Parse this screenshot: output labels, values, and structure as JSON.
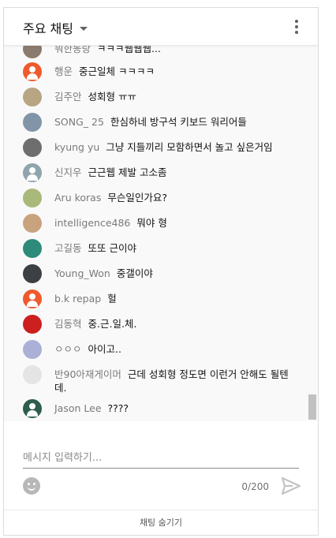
{
  "header": {
    "title": "주요 채팅",
    "menu_icon": "more-vert-icon"
  },
  "messages": [
    {
      "author": "뭐한동랑",
      "text": "ㅋㅋㅋ웹웹웹...",
      "avatar": "photo",
      "color": "#8a7b6e"
    },
    {
      "author": "행운",
      "text": "중근일체 ㅋㅋㅋㅋ",
      "avatar": "default",
      "color": "#ef5a2d"
    },
    {
      "author": "김주안",
      "text": "성회형 ㅠㅠ",
      "avatar": "photo",
      "color": "#b7a583"
    },
    {
      "author": "SONG_ 25",
      "text": "한심하네 방구석 키보드 워리어들",
      "avatar": "photo",
      "color": "#8294a8"
    },
    {
      "author": "kyung yu",
      "text": "그냥 지들끼리 모함하면서 놀고 싶은거임",
      "avatar": "photo",
      "color": "#6e6e6e"
    },
    {
      "author": "신지우",
      "text": "근근웹 제발 고소좀",
      "avatar": "default",
      "color": "#90a4ae"
    },
    {
      "author": "Aru koras",
      "text": "무슨일인가요?",
      "avatar": "photo",
      "color": "#a8b97a"
    },
    {
      "author": "intelligence486",
      "text": "뭐야 형",
      "avatar": "photo",
      "color": "#c9a27e"
    },
    {
      "author": "고길동",
      "text": "또또 근이야",
      "avatar": "photo",
      "color": "#2e8b7a"
    },
    {
      "author": "Young_Won",
      "text": "중갤이야",
      "avatar": "photo",
      "color": "#3c3f44"
    },
    {
      "author": "b.k repap",
      "text": "헐",
      "avatar": "default",
      "color": "#ef5a2d"
    },
    {
      "author": "김동혁",
      "text": "중.근.일.체.",
      "avatar": "photo",
      "color": "#cc1f1f"
    },
    {
      "author": "ㅇㅇㅇ",
      "text": "아이고..",
      "avatar": "photo",
      "color": "#aab0d6"
    },
    {
      "author": "반90아재게이머",
      "text": "근데 성회형 정도면 이런거 안해도 될텐데.",
      "avatar": "photo",
      "color": "#e4e4e4"
    },
    {
      "author": "Jason Lee",
      "text": "????",
      "avatar": "default",
      "color": "#2d5d4e"
    }
  ],
  "composer": {
    "placeholder": "메시지 입력하기...",
    "counter": "0/200",
    "emoji_icon": "emoji-icon",
    "send_icon": "send-icon"
  },
  "footer": {
    "hide_label": "채팅 숨기기"
  }
}
